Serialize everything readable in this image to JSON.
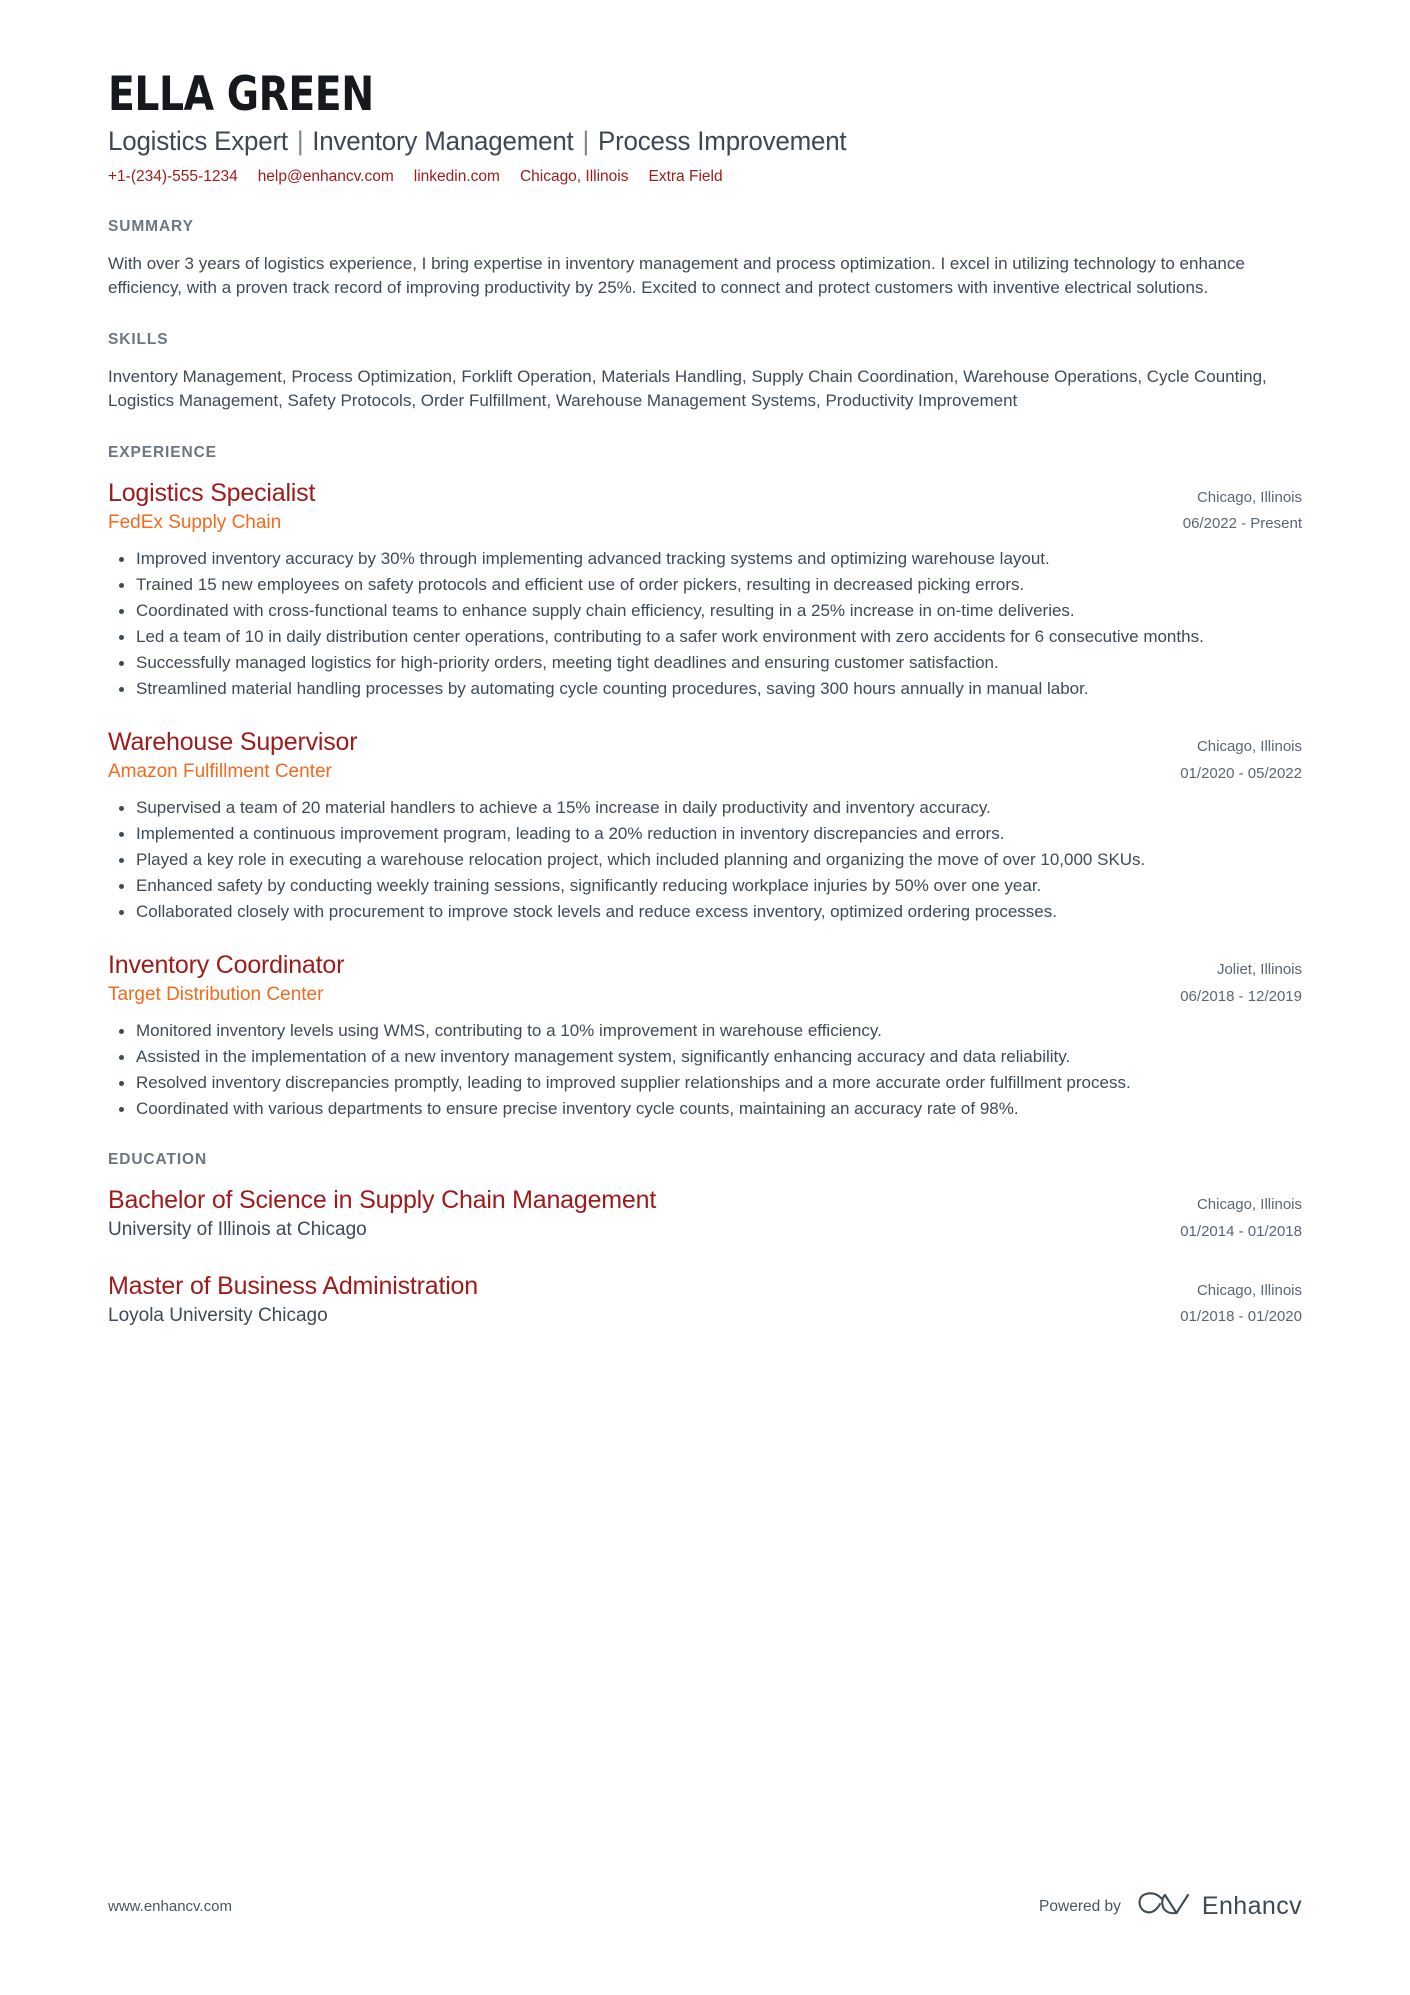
{
  "header": {
    "full_name": "ELLA GREEN",
    "headline_parts": [
      "Logistics Expert",
      "Inventory Management",
      "Process Improvement"
    ],
    "headline_separator": "|",
    "contacts": [
      {
        "name": "phone",
        "value": "+1-(234)-555-1234"
      },
      {
        "name": "email",
        "value": "help@enhancv.com"
      },
      {
        "name": "linkedin",
        "value": "linkedin.com"
      },
      {
        "name": "location",
        "value": "Chicago, Illinois"
      },
      {
        "name": "extra",
        "value": "Extra Field"
      }
    ],
    "accent_color": "#9e1b1b"
  },
  "summary": {
    "title": "SUMMARY",
    "text": "With over 3 years of logistics experience, I bring expertise in inventory management and process optimization. I excel in utilizing technology to enhance efficiency, with a proven track record of improving productivity by 25%. Excited to connect and protect customers with inventive electrical solutions."
  },
  "skills": {
    "title": "SKILLS",
    "text": "Inventory Management, Process Optimization, Forklift Operation, Materials Handling, Supply Chain Coordination, Warehouse Operations, Cycle Counting, Logistics Management, Safety Protocols, Order Fulfillment, Warehouse Management Systems, Productivity Improvement"
  },
  "experience": {
    "title": "EXPERIENCE",
    "entries": [
      {
        "role": "Logistics Specialist",
        "company": "FedEx Supply Chain",
        "location": "Chicago, Illinois",
        "dates": "06/2022 - Present",
        "bullets": [
          "Improved inventory accuracy by 30% through implementing advanced tracking systems and optimizing warehouse layout.",
          "Trained 15 new employees on safety protocols and efficient use of order pickers, resulting in decreased picking errors.",
          "Coordinated with cross-functional teams to enhance supply chain efficiency, resulting in a 25% increase in on-time deliveries.",
          "Led a team of 10 in daily distribution center operations, contributing to a safer work environment with zero accidents for 6 consecutive months.",
          "Successfully managed logistics for high-priority orders, meeting tight deadlines and ensuring customer satisfaction.",
          "Streamlined material handling processes by automating cycle counting procedures, saving 300 hours annually in manual labor."
        ]
      },
      {
        "role": "Warehouse Supervisor",
        "company": "Amazon Fulfillment Center",
        "location": "Chicago, Illinois",
        "dates": "01/2020 - 05/2022",
        "bullets": [
          "Supervised a team of 20 material handlers to achieve a 15% increase in daily productivity and inventory accuracy.",
          "Implemented a continuous improvement program, leading to a 20% reduction in inventory discrepancies and errors.",
          "Played a key role in executing a warehouse relocation project, which included planning and organizing the move of over 10,000 SKUs.",
          "Enhanced safety by conducting weekly training sessions, significantly reducing workplace injuries by 50% over one year.",
          "Collaborated closely with procurement to improve stock levels and reduce excess inventory, optimized ordering processes."
        ]
      },
      {
        "role": "Inventory Coordinator",
        "company": "Target Distribution Center",
        "location": "Joliet, Illinois",
        "dates": "06/2018 - 12/2019",
        "bullets": [
          "Monitored inventory levels using WMS, contributing to a 10% improvement in warehouse efficiency.",
          "Assisted in the implementation of a new inventory management system, significantly enhancing accuracy and data reliability.",
          "Resolved inventory discrepancies promptly, leading to improved supplier relationships and a more accurate order fulfillment process.",
          "Coordinated with various departments to ensure precise inventory cycle counts, maintaining an accuracy rate of 98%."
        ]
      }
    ]
  },
  "education": {
    "title": "EDUCATION",
    "entries": [
      {
        "degree": "Bachelor of Science in Supply Chain Management",
        "school": "University of Illinois at Chicago",
        "location": "Chicago, Illinois",
        "dates": "01/2014 - 01/2018"
      },
      {
        "degree": "Master of Business Administration",
        "school": "Loyola University Chicago",
        "location": "Chicago, Illinois",
        "dates": "01/2018 - 01/2020"
      }
    ]
  },
  "footer": {
    "website": "www.enhancv.com",
    "powered_by_label": "Powered by",
    "brand_name": "Enhancv"
  }
}
